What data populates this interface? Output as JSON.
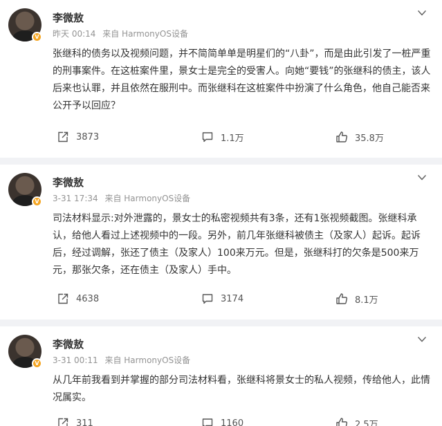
{
  "posts": [
    {
      "author": "李微敖",
      "time": "昨天 00:14",
      "source": "来自 HarmonyOS设备",
      "text": "张继科的债务以及视频问题，并不简简单单是明星们的“八卦”，而是由此引发了一桩严重的刑事案件。在这桩案件里，景女士是完全的受害人。向她“要钱”的张继科的债主，该人后来也认罪，并且依然在服刑中。而张继科在这桩案件中扮演了什么角色，他自己能否来公开予以回应？",
      "reposts": "3873",
      "comments": "1.1万",
      "likes": "35.8万"
    },
    {
      "author": "李微敖",
      "time": "3-31 17:34",
      "source": "来自 HarmonyOS设备",
      "text": "司法材料显示:对外泄露的，景女士的私密视频共有3条，还有1张视频截图。张继科承认，给他人看过上述视频中的一段。另外，前几年张继科被债主（及家人）起诉。起诉后，经过调解，张还了债主（及家人）100来万元。但是，张继科打的欠条是500来万元，那张欠条，还在债主（及家人）手中。",
      "reposts": "4638",
      "comments": "3174",
      "likes": "8.1万"
    },
    {
      "author": "李微敖",
      "time": "3-31 00:11",
      "source": "来自 HarmonyOS设备",
      "text": "从几年前我看到并掌握的部分司法材料看，张继科将景女士的私人视频，传给他人，此情况属实。",
      "reposts": "311",
      "comments": "1160",
      "likes": "2.5万"
    }
  ],
  "icons": {
    "repost": "repost-icon",
    "comment": "comment-icon",
    "like": "thumbs-up-icon",
    "more": "chevron-down-icon",
    "verified": "verified-badge-icon"
  },
  "colors": {
    "page_bg": "#f1f2f5",
    "card_bg": "#ffffff",
    "meta_text": "#939393",
    "badge": "#f5a623"
  }
}
